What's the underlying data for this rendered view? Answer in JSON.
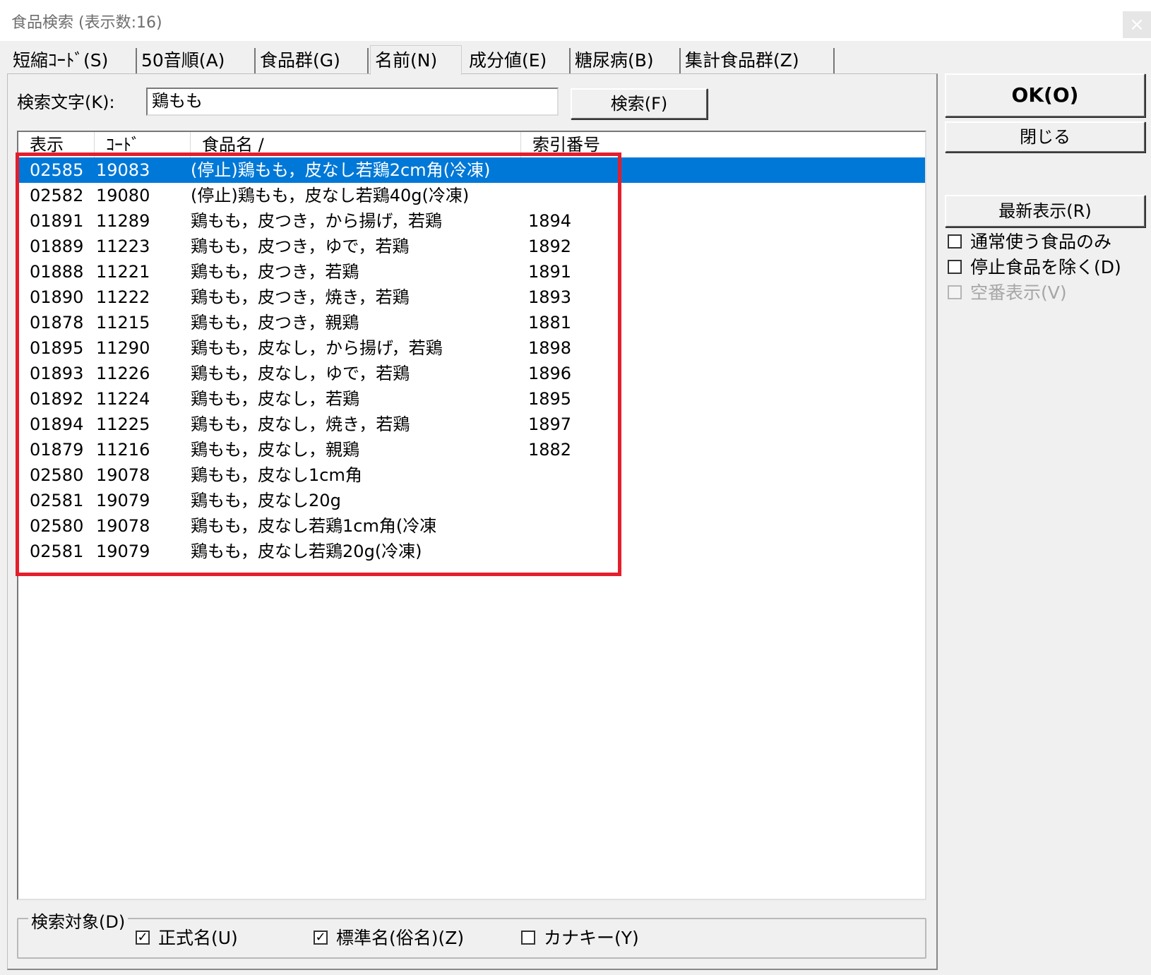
{
  "window": {
    "title": "食品検索 (表示数:16)",
    "close_glyph": "×"
  },
  "tabs": [
    {
      "label": "短縮ｺｰﾄﾞ(S)",
      "active": false
    },
    {
      "label": "50音順(A)",
      "active": false
    },
    {
      "label": "食品群(G)",
      "active": false
    },
    {
      "label": "名前(N)",
      "active": true
    },
    {
      "label": "成分値(E)",
      "active": false
    },
    {
      "label": "糖尿病(B)",
      "active": false
    },
    {
      "label": "集計食品群(Z)",
      "active": false
    }
  ],
  "search": {
    "label": "検索文字(K):",
    "value": "鶏もも",
    "button": "検索(F)"
  },
  "list": {
    "headers": [
      "表示",
      "ｺｰﾄﾞ",
      "食品名 /",
      "索引番号"
    ],
    "rows": [
      {
        "disp": "02585",
        "code": "19083",
        "name": "(停止)鶏もも，皮なし若鶏2cm角(冷凍)",
        "index": "",
        "selected": true
      },
      {
        "disp": "02582",
        "code": "19080",
        "name": "(停止)鶏もも，皮なし若鶏40g(冷凍)",
        "index": ""
      },
      {
        "disp": "01891",
        "code": "11289",
        "name": "鶏もも，皮つき，から揚げ，若鶏",
        "index": "1894"
      },
      {
        "disp": "01889",
        "code": "11223",
        "name": "鶏もも，皮つき，ゆで，若鶏",
        "index": "1892"
      },
      {
        "disp": "01888",
        "code": "11221",
        "name": "鶏もも，皮つき，若鶏",
        "index": "1891"
      },
      {
        "disp": "01890",
        "code": "11222",
        "name": "鶏もも，皮つき，焼き，若鶏",
        "index": "1893"
      },
      {
        "disp": "01878",
        "code": "11215",
        "name": "鶏もも，皮つき，親鶏",
        "index": "1881"
      },
      {
        "disp": "01895",
        "code": "11290",
        "name": "鶏もも，皮なし，から揚げ，若鶏",
        "index": "1898"
      },
      {
        "disp": "01893",
        "code": "11226",
        "name": "鶏もも，皮なし，ゆで，若鶏",
        "index": "1896"
      },
      {
        "disp": "01892",
        "code": "11224",
        "name": "鶏もも，皮なし，若鶏",
        "index": "1895"
      },
      {
        "disp": "01894",
        "code": "11225",
        "name": "鶏もも，皮なし，焼き，若鶏",
        "index": "1897"
      },
      {
        "disp": "01879",
        "code": "11216",
        "name": "鶏もも，皮なし，親鶏",
        "index": "1882"
      },
      {
        "disp": "02580",
        "code": "19078",
        "name": "鶏もも，皮なし1cm角",
        "index": ""
      },
      {
        "disp": "02581",
        "code": "19079",
        "name": "鶏もも，皮なし20g",
        "index": ""
      },
      {
        "disp": "02580",
        "code": "19078",
        "name": "鶏もも，皮なし若鶏1cm角(冷凍",
        "index": ""
      },
      {
        "disp": "02581",
        "code": "19079",
        "name": "鶏もも，皮なし若鶏20g(冷凍)",
        "index": ""
      }
    ]
  },
  "search_target": {
    "legend": "検索対象(D)",
    "options": [
      {
        "label": "正式名(U)",
        "checked": true
      },
      {
        "label": "標準名(俗名)(Z)",
        "checked": true
      },
      {
        "label": "カナキー(Y)",
        "checked": false
      }
    ]
  },
  "side": {
    "ok": "OK(O)",
    "close": "閉じる",
    "refresh": "最新表示(R)",
    "filters": [
      {
        "label": "通常使う食品のみ",
        "checked": false,
        "disabled": false
      },
      {
        "label": "停止食品を除く(D)",
        "checked": false,
        "disabled": false
      },
      {
        "label": "空番表示(V)",
        "checked": false,
        "disabled": true
      }
    ]
  },
  "colors": {
    "selection": "#0078d7",
    "highlight_frame": "#e41e2b"
  }
}
